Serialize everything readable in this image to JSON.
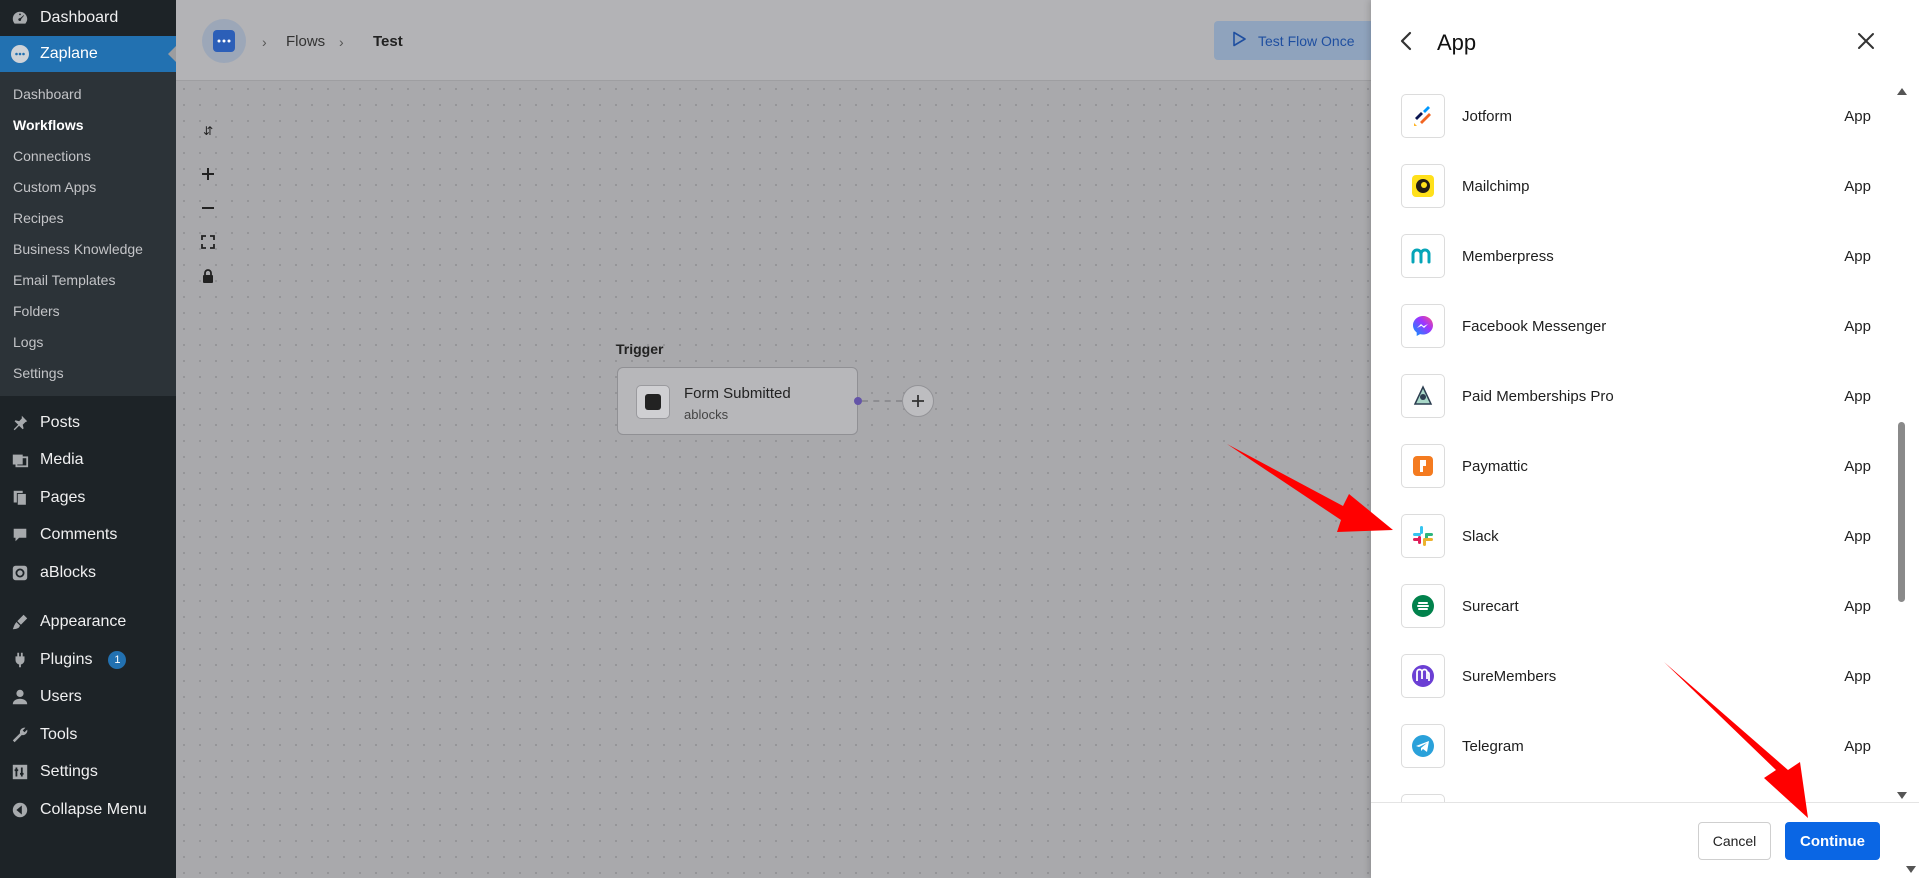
{
  "wp_sidebar": {
    "top_items": [
      {
        "label": "Dashboard",
        "icon": "dashboard-icon"
      },
      {
        "label": "Zaplane",
        "icon": "zaplane-icon"
      }
    ],
    "submenu": [
      {
        "label": "Dashboard"
      },
      {
        "label": "Workflows"
      },
      {
        "label": "Connections"
      },
      {
        "label": "Custom Apps"
      },
      {
        "label": "Recipes"
      },
      {
        "label": "Business Knowledge"
      },
      {
        "label": "Email Templates"
      },
      {
        "label": "Folders"
      },
      {
        "label": "Logs"
      },
      {
        "label": "Settings"
      }
    ],
    "menu": [
      {
        "label": "Posts",
        "icon": "pin-icon"
      },
      {
        "label": "Media",
        "icon": "media-icon"
      },
      {
        "label": "Pages",
        "icon": "pages-icon"
      },
      {
        "label": "Comments",
        "icon": "comment-icon"
      },
      {
        "label": "aBlocks",
        "icon": "ablocks-icon"
      },
      {
        "label": "Appearance",
        "icon": "brush-icon"
      },
      {
        "label": "Plugins",
        "icon": "plugin-icon",
        "badge": "1"
      },
      {
        "label": "Users",
        "icon": "user-icon"
      },
      {
        "label": "Tools",
        "icon": "wrench-icon"
      },
      {
        "label": "Settings",
        "icon": "settings-icon"
      },
      {
        "label": "Collapse Menu",
        "icon": "collapse-icon"
      }
    ]
  },
  "topbar": {
    "breadcrumb": [
      "Flows",
      "Test"
    ],
    "test_flow_label": "Test Flow Once"
  },
  "canvas": {
    "trigger_label": "Trigger",
    "node_title": "Form Submitted",
    "node_subtitle": "ablocks"
  },
  "panel": {
    "title": "App",
    "apps": [
      {
        "name": "Jotform",
        "type": "App",
        "icon": "jotform-icon",
        "color": "#f26522"
      },
      {
        "name": "Mailchimp",
        "type": "App",
        "icon": "mailchimp-icon",
        "color": "#ffe01b"
      },
      {
        "name": "Memberpress",
        "type": "App",
        "icon": "memberpress-icon",
        "color": "#06a5b8"
      },
      {
        "name": "Facebook Messenger",
        "type": "App",
        "icon": "messenger-icon",
        "color": "#a334fa"
      },
      {
        "name": "Paid Memberships Pro",
        "type": "App",
        "icon": "pmpro-icon",
        "color": "#2c3e50"
      },
      {
        "name": "Paymattic",
        "type": "App",
        "icon": "paymattic-icon",
        "color": "#f47b20"
      },
      {
        "name": "Slack",
        "type": "App",
        "icon": "slack-icon",
        "color": "#e01e5a"
      },
      {
        "name": "Surecart",
        "type": "App",
        "icon": "surecart-icon",
        "color": "#01824c"
      },
      {
        "name": "SureMembers",
        "type": "App",
        "icon": "suremembers-icon",
        "color": "#6b3fd4"
      },
      {
        "name": "Telegram",
        "type": "App",
        "icon": "telegram-icon",
        "color": "#2aa1da"
      }
    ],
    "cancel_label": "Cancel",
    "continue_label": "Continue"
  },
  "colors": {
    "wp_sidebar_bg": "#1d2327",
    "wp_accent": "#2271b1",
    "continue_button": "#0a66e4",
    "annotation_arrow": "#ff0000"
  }
}
